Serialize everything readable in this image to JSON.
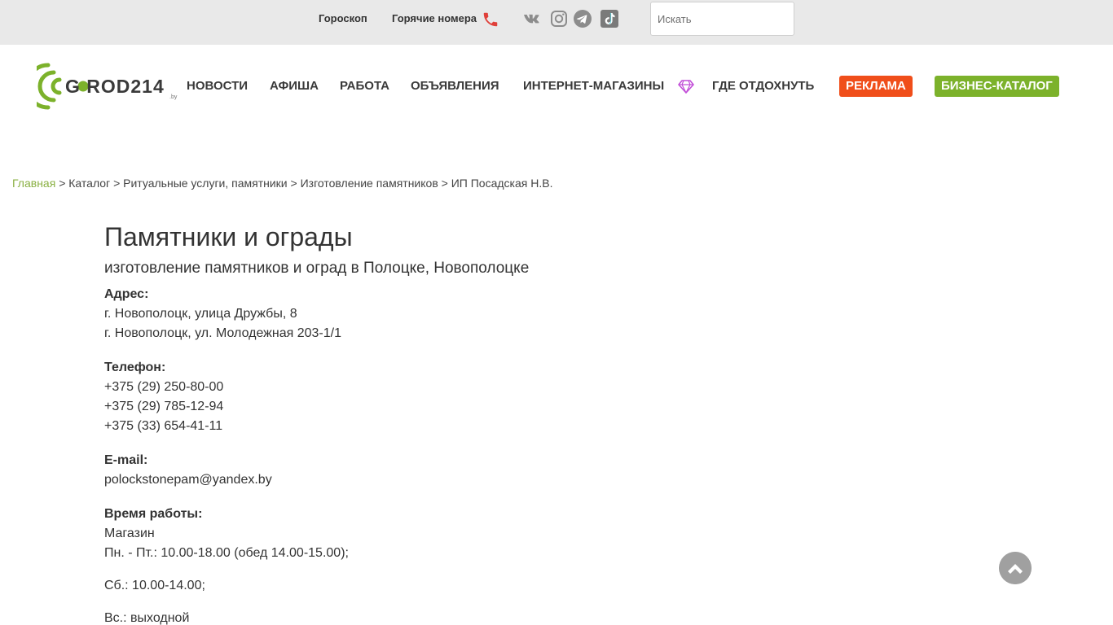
{
  "topbar": {
    "horoscope_label": "Гороскоп",
    "hotnumbers_label": "Горячие номера",
    "search_placeholder": "Искать"
  },
  "icons": {
    "phone": "phone-icon",
    "vk": "vk-icon",
    "instagram": "instagram-icon",
    "telegram": "telegram-icon",
    "tiktok": "tiktok-icon",
    "gem": "gem-icon",
    "scroll_top": "chevron-up-icon"
  },
  "logo": {
    "text": "G ROD214",
    "suffix": ".by"
  },
  "nav": {
    "items": [
      "НОВОСТИ",
      "АФИША",
      "РАБОТА",
      "ОБЪЯВЛЕНИЯ",
      "ИНТЕРНЕТ-МАГАЗИНЫ",
      "ГДЕ ОТДОХНУТЬ",
      "РЕКЛАМА",
      "БИЗНЕС-КАТАЛОГ"
    ]
  },
  "breadcrumb": {
    "items": [
      "Главная",
      "Каталог",
      "Ритуальные услуги, памятники",
      "Изготовление памятников",
      "ИП Посадская Н.В."
    ],
    "separator": ">"
  },
  "main": {
    "title": "Памятники и ограды",
    "subtitle": "изготовление памятников и оград в Полоцке, Новополоцке",
    "address_label": "Адрес:",
    "addresses": [
      "г. Новополоцк, улица Дружбы, 8",
      "г. Новополоцк, ул. Молодежная 203-1/1"
    ],
    "phone_label": "Телефон:",
    "phones": [
      "+375 (29) 250-80-00",
      "+375 (29) 785-12-94",
      "+375 (33) 654-41-11"
    ],
    "email_label": "E-mail:",
    "email": "polockstonepam@yandex.by",
    "hours_label": "Время работы:",
    "hours": [
      "Магазин",
      "Пн. - Пт.: 10.00-18.00 (обед 14.00-15.00);",
      "Сб.: 10.00-14.00;",
      "Вс.: выходной"
    ]
  },
  "colors": {
    "brand_green": "#7cb22b",
    "accent_orange": "#f04e1a",
    "phone_red": "#e0403a",
    "gem_purple": "#c24fd8",
    "topbar_bg": "#e9e9e9"
  }
}
